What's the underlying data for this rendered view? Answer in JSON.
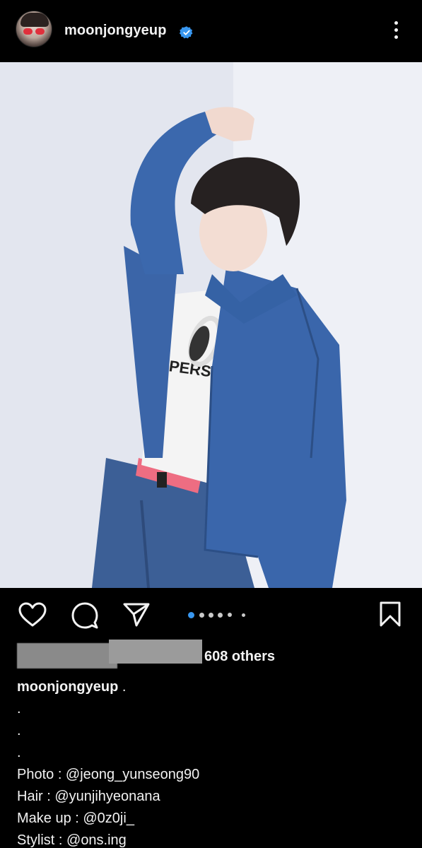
{
  "header": {
    "username": "moonjongyeup",
    "verified": true,
    "avatar_icon": "profile-avatar",
    "more_icon": "more-vertical-icon"
  },
  "post": {
    "image_description_icon": "post-photo",
    "carousel": {
      "total": 6,
      "current": 1
    },
    "accent_color": "#3897f0"
  },
  "actions": {
    "like_icon": "heart-icon",
    "comment_icon": "comment-icon",
    "share_icon": "send-icon",
    "save_icon": "bookmark-icon"
  },
  "likes": {
    "others_text": "608 others"
  },
  "caption": {
    "username": "moonjongyeup",
    "first_line_text": " .",
    "lines": [
      ".",
      ".",
      ".",
      "Photo : @jeong_yunseong90",
      "Hair : @yunjihyeonana",
      "Make up : @0z0ji_",
      "Stylist : @ons.ing"
    ]
  }
}
